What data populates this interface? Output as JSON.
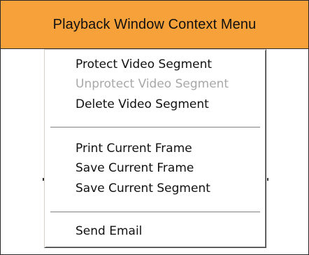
{
  "header": {
    "title": "Playback Window Context Menu"
  },
  "menu": {
    "items": [
      {
        "label": "Protect Video Segment",
        "enabled": true
      },
      {
        "label": "Unprotect Video Segment",
        "enabled": false
      },
      {
        "label": "Delete Video Segment",
        "enabled": true
      },
      {
        "label": "Print Current Frame",
        "enabled": true
      },
      {
        "label": "Save Current Frame",
        "enabled": true
      },
      {
        "label": "Save Current Segment",
        "enabled": true
      },
      {
        "label": "Send Email",
        "enabled": true
      }
    ]
  },
  "colors": {
    "header_background": "#f7a13a",
    "frame_border": "#2a2a2a",
    "menu_background": "#ffffff",
    "disabled_text": "#a8a8a8"
  }
}
